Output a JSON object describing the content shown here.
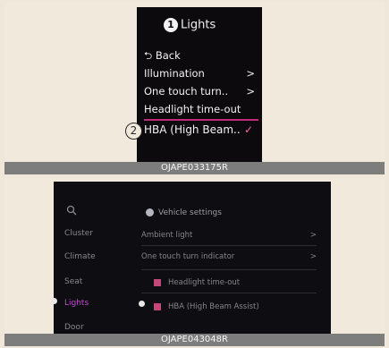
{
  "figure1": {
    "marker": "1",
    "title": "Lights",
    "back": "⮌ Back",
    "items": [
      {
        "label": "Illumination",
        "arrow": ">"
      },
      {
        "label": "One touch turn..",
        "arrow": ">"
      },
      {
        "label": "Headlight time-out",
        "arrow": ""
      }
    ],
    "selected": {
      "marker": "2",
      "label": "HBA (High Beam..",
      "check": "✓"
    },
    "caption": "OJAPE033175R"
  },
  "figure2": {
    "sidebar": [
      "Cluster",
      "Climate",
      "Seat",
      "Lights",
      "Door"
    ],
    "active_item": "Lights",
    "title": "Vehicle settings",
    "items": [
      {
        "label": "Ambient light",
        "chevron": ">"
      },
      {
        "label": "One touch turn indicator",
        "chevron": ">"
      },
      {
        "label": "Headlight time-out",
        "checked": true
      },
      {
        "label": "HBA (High Beam Assist)",
        "checked": true
      }
    ],
    "caption": "OJAPE043048R"
  },
  "colors": {
    "accent": "#c22a78",
    "screen": "#0c0a0c",
    "caption_bar": "#7d7d7d"
  },
  "icons": [
    "search-icon",
    "check-icon",
    "chevron-right-icon",
    "back-arrow-icon"
  ]
}
